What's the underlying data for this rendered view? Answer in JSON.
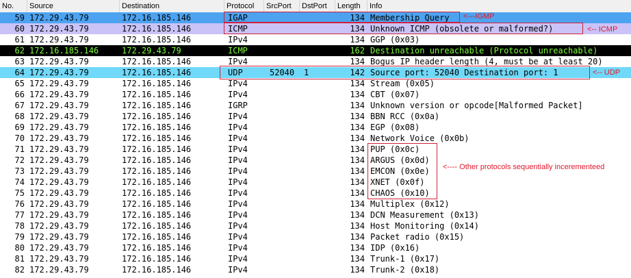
{
  "columns": [
    "No.",
    "Source",
    "Destination",
    "Protocol",
    "SrcPort",
    "DstPort",
    "Length",
    "Info"
  ],
  "colors": {
    "igap_row": "#4da3f0",
    "icmp_obsolete_row": "#c9c3f7",
    "icmp_unreach_row": "#000000",
    "icmp_unreach_text": "#7fff3a",
    "udp_row": "#70d8f8",
    "annotation_red": "#e0182c"
  },
  "packets": [
    {
      "no": "59",
      "src": "172.29.43.79",
      "dst": "172.16.185.146",
      "proto": "IGAP",
      "sport": "",
      "dport": "",
      "len": "134",
      "info": "Membership Query",
      "style": "igap"
    },
    {
      "no": "60",
      "src": "172.29.43.79",
      "dst": "172.16.185.146",
      "proto": "ICMP",
      "sport": "",
      "dport": "",
      "len": "134",
      "info": "Unknown ICMP (obsolete or malformed?)",
      "style": "icmp_obsolete"
    },
    {
      "no": "61",
      "src": "172.29.43.79",
      "dst": "172.16.185.146",
      "proto": "IPv4",
      "sport": "",
      "dport": "",
      "len": "134",
      "info": "GGP (0x03)",
      "style": ""
    },
    {
      "no": "62",
      "src": "172.16.185.146",
      "dst": "172.29.43.79",
      "proto": "ICMP",
      "sport": "",
      "dport": "",
      "len": "162",
      "info": "Destination unreachable (Protocol unreachable)",
      "style": "icmp_unreach"
    },
    {
      "no": "63",
      "src": "172.29.43.79",
      "dst": "172.16.185.146",
      "proto": "IPv4",
      "sport": "",
      "dport": "",
      "len": "134",
      "info": "Bogus IP header length (4, must be at least 20)",
      "style": ""
    },
    {
      "no": "64",
      "src": "172.29.43.79",
      "dst": "172.16.185.146",
      "proto": "UDP",
      "sport": "52040",
      "dport": "1",
      "len": "142",
      "info": "Source port: 52040  Destination port: 1",
      "style": "udp"
    },
    {
      "no": "65",
      "src": "172.29.43.79",
      "dst": "172.16.185.146",
      "proto": "IPv4",
      "sport": "",
      "dport": "",
      "len": "134",
      "info": "Stream (0x05)",
      "style": ""
    },
    {
      "no": "66",
      "src": "172.29.43.79",
      "dst": "172.16.185.146",
      "proto": "IPv4",
      "sport": "",
      "dport": "",
      "len": "134",
      "info": "CBT (0x07)",
      "style": ""
    },
    {
      "no": "67",
      "src": "172.29.43.79",
      "dst": "172.16.185.146",
      "proto": "IGRP",
      "sport": "",
      "dport": "",
      "len": "134",
      "info": "Unknown version or opcode[Malformed Packet]",
      "style": ""
    },
    {
      "no": "68",
      "src": "172.29.43.79",
      "dst": "172.16.185.146",
      "proto": "IPv4",
      "sport": "",
      "dport": "",
      "len": "134",
      "info": "BBN RCC (0x0a)",
      "style": ""
    },
    {
      "no": "69",
      "src": "172.29.43.79",
      "dst": "172.16.185.146",
      "proto": "IPv4",
      "sport": "",
      "dport": "",
      "len": "134",
      "info": "EGP (0x08)",
      "style": ""
    },
    {
      "no": "70",
      "src": "172.29.43.79",
      "dst": "172.16.185.146",
      "proto": "IPv4",
      "sport": "",
      "dport": "",
      "len": "134",
      "info": "Network Voice (0x0b)",
      "style": ""
    },
    {
      "no": "71",
      "src": "172.29.43.79",
      "dst": "172.16.185.146",
      "proto": "IPv4",
      "sport": "",
      "dport": "",
      "len": "134",
      "info": "PUP (0x0c)",
      "style": ""
    },
    {
      "no": "72",
      "src": "172.29.43.79",
      "dst": "172.16.185.146",
      "proto": "IPv4",
      "sport": "",
      "dport": "",
      "len": "134",
      "info": "ARGUS (0x0d)",
      "style": ""
    },
    {
      "no": "73",
      "src": "172.29.43.79",
      "dst": "172.16.185.146",
      "proto": "IPv4",
      "sport": "",
      "dport": "",
      "len": "134",
      "info": "EMCON (0x0e)",
      "style": ""
    },
    {
      "no": "74",
      "src": "172.29.43.79",
      "dst": "172.16.185.146",
      "proto": "IPv4",
      "sport": "",
      "dport": "",
      "len": "134",
      "info": "XNET (0x0f)",
      "style": ""
    },
    {
      "no": "75",
      "src": "172.29.43.79",
      "dst": "172.16.185.146",
      "proto": "IPv4",
      "sport": "",
      "dport": "",
      "len": "134",
      "info": "CHAOS (0x10)",
      "style": ""
    },
    {
      "no": "76",
      "src": "172.29.43.79",
      "dst": "172.16.185.146",
      "proto": "IPv4",
      "sport": "",
      "dport": "",
      "len": "134",
      "info": "Multiplex (0x12)",
      "style": ""
    },
    {
      "no": "77",
      "src": "172.29.43.79",
      "dst": "172.16.185.146",
      "proto": "IPv4",
      "sport": "",
      "dport": "",
      "len": "134",
      "info": "DCN Measurement (0x13)",
      "style": ""
    },
    {
      "no": "78",
      "src": "172.29.43.79",
      "dst": "172.16.185.146",
      "proto": "IPv4",
      "sport": "",
      "dport": "",
      "len": "134",
      "info": "Host Monitoring (0x14)",
      "style": ""
    },
    {
      "no": "79",
      "src": "172.29.43.79",
      "dst": "172.16.185.146",
      "proto": "IPv4",
      "sport": "",
      "dport": "",
      "len": "134",
      "info": "Packet radio (0x15)",
      "style": ""
    },
    {
      "no": "80",
      "src": "172.29.43.79",
      "dst": "172.16.185.146",
      "proto": "IPv4",
      "sport": "",
      "dport": "",
      "len": "134",
      "info": "IDP (0x16)",
      "style": ""
    },
    {
      "no": "81",
      "src": "172.29.43.79",
      "dst": "172.16.185.146",
      "proto": "IPv4",
      "sport": "",
      "dport": "",
      "len": "134",
      "info": "Trunk-1 (0x17)",
      "style": ""
    },
    {
      "no": "82",
      "src": "172.29.43.79",
      "dst": "172.16.185.146",
      "proto": "IPv4",
      "sport": "",
      "dport": "",
      "len": "134",
      "info": "Trunk-2 (0x18)",
      "style": ""
    }
  ],
  "annotations": {
    "igmp": "<---IGMP",
    "icmp": "<-- ICMP",
    "udp": "<-- UDP",
    "other": "<---- Other protocols sequentially incerementeed"
  }
}
